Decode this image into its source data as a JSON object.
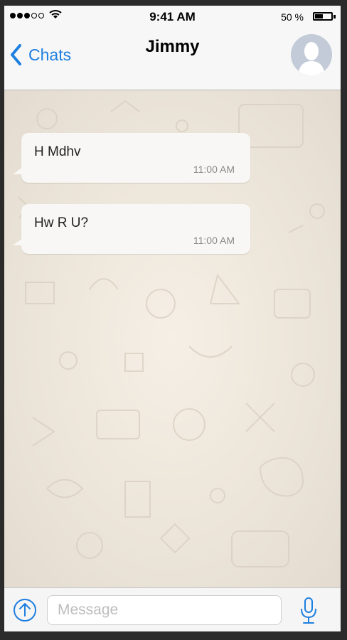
{
  "status_bar": {
    "time": "9:41 AM",
    "battery_text": "50 %",
    "battery_level": 0.5,
    "signal_bars_filled": 3,
    "signal_bars_total": 5
  },
  "nav": {
    "back_label": "Chats",
    "contact_name": "Jimmy",
    "back_icon": "chevron-left-icon",
    "avatar_icon": "person-silhouette-icon"
  },
  "messages": [
    {
      "text": "H Mdhv",
      "time": "11:00 AM"
    },
    {
      "text": "Hw R U?",
      "time": "11:00 AM"
    }
  ],
  "input_bar": {
    "placeholder": "Message",
    "upload_icon": "upload-icon",
    "mic_icon": "microphone-icon"
  },
  "colors": {
    "accent": "#1e7fe0",
    "chat_background": "#ece5d9",
    "bubble": "#f8f7f5"
  }
}
